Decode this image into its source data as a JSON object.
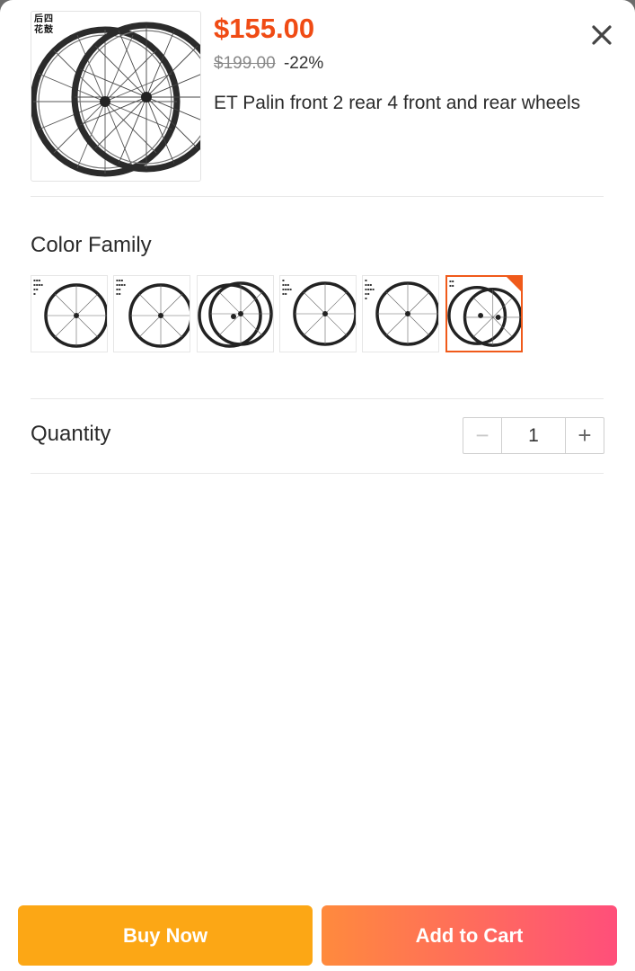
{
  "product": {
    "price": "$155.00",
    "original_price": "$199.00",
    "discount": "-22%",
    "title": "ET Palin front 2 rear 4 front and rear wheels",
    "image_caption": "后四\n花鼓"
  },
  "color_family": {
    "label": "Color Family",
    "selected_index": 5,
    "options": [
      {
        "image": "single-wheel"
      },
      {
        "image": "single-wheel"
      },
      {
        "image": "wheel-pair"
      },
      {
        "image": "single-wheel"
      },
      {
        "image": "single-wheel"
      },
      {
        "image": "wheel-pair"
      }
    ]
  },
  "quantity": {
    "label": "Quantity",
    "value": "1",
    "minus_symbol": "−",
    "plus_symbol": "+"
  },
  "actions": {
    "buy_now": "Buy Now",
    "add_to_cart": "Add to Cart"
  },
  "colors": {
    "price": "#f04b14",
    "accent": "#f05a1a",
    "buy_now": "#fca715",
    "cart_gradient_start": "#ff8a3d",
    "cart_gradient_end": "#ff4f7a"
  },
  "icons": {
    "close": "close-icon"
  }
}
